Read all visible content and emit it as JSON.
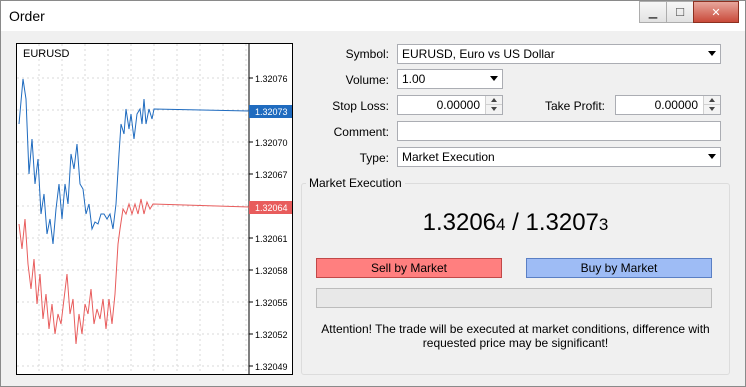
{
  "window": {
    "title": "Order"
  },
  "window_buttons": {
    "minimize": "▁",
    "maximize": "☐",
    "close": "✕"
  },
  "chart": {
    "symbol": "EURUSD",
    "y_ticks": [
      "1.32076",
      "1.32073",
      "1.32070",
      "1.32067",
      "1.32064",
      "1.32061",
      "1.32058",
      "1.32055",
      "1.32052",
      "1.32049"
    ],
    "ask_label": "1.32073",
    "bid_label": "1.32064",
    "ask_color": "#1f6bbf",
    "bid_color": "#e85c5c"
  },
  "form": {
    "symbol_label": "Symbol:",
    "symbol_value": "EURUSD, Euro vs US Dollar",
    "volume_label": "Volume:",
    "volume_value": "1.00",
    "stop_loss_label": "Stop Loss:",
    "stop_loss_value": "0.00000",
    "take_profit_label": "Take Profit:",
    "take_profit_value": "0.00000",
    "comment_label": "Comment:",
    "comment_value": "",
    "type_label": "Type:",
    "type_value": "Market Execution"
  },
  "execution": {
    "group_title": "Market Execution",
    "bid_main": "1.3206",
    "bid_small": "4",
    "separator": " / ",
    "ask_main": "1.3207",
    "ask_small": "3",
    "sell_label": "Sell by Market",
    "buy_label": "Buy by Market",
    "attention": "Attention! The trade will be executed at market conditions, difference with requested price may be significant!"
  }
}
